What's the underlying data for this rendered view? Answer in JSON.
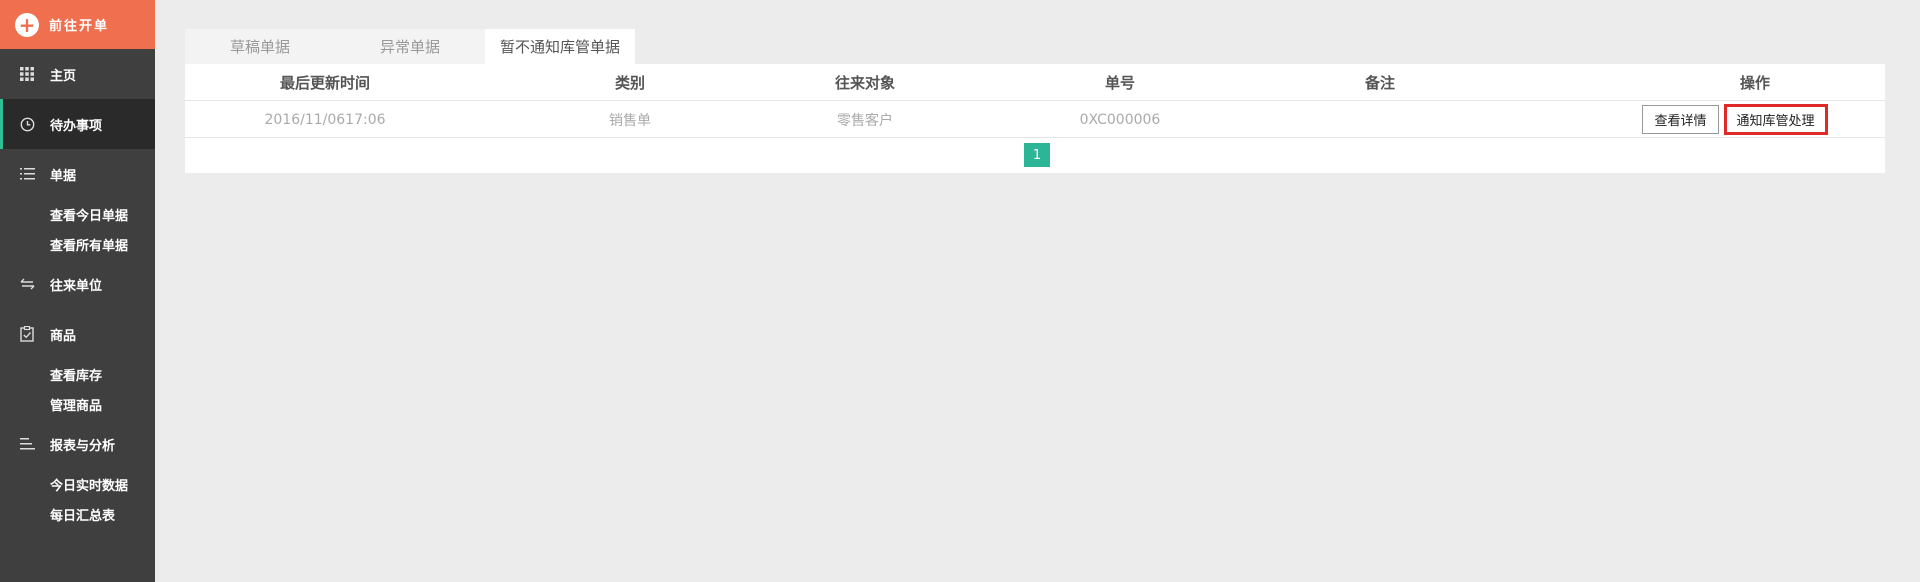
{
  "sidebar": {
    "open_button": "前往开单",
    "home": "主页",
    "todo": "待办事项",
    "orders": {
      "label": "单据",
      "items": [
        "查看今日单据",
        "查看所有单据"
      ]
    },
    "partners": "往来单位",
    "goods": {
      "label": "商品",
      "items": [
        "查看库存",
        "管理商品"
      ]
    },
    "reports": {
      "label": "报表与分析",
      "items": [
        "今日实时数据",
        "每日汇总表"
      ]
    }
  },
  "tabs": [
    "草稿单据",
    "异常单据",
    "暂不通知库管单据"
  ],
  "active_tab": "暂不通知库管单据",
  "table": {
    "headers": [
      "最后更新时间",
      "类别",
      "往来对象",
      "单号",
      "备注",
      "操作"
    ],
    "rows": [
      {
        "time": "2016/11/0617:06",
        "category": "销售单",
        "partner": "零售客户",
        "number": "0XC000006",
        "note": "",
        "actions": [
          "查看详情",
          "通知库管处理"
        ]
      }
    ]
  },
  "pagination": {
    "current": "1"
  },
  "colors": {
    "accent": "#ef6f4f",
    "sidebar": "#3f3f3f",
    "page_active": "#2cb597",
    "highlight": "#e02a2a"
  }
}
